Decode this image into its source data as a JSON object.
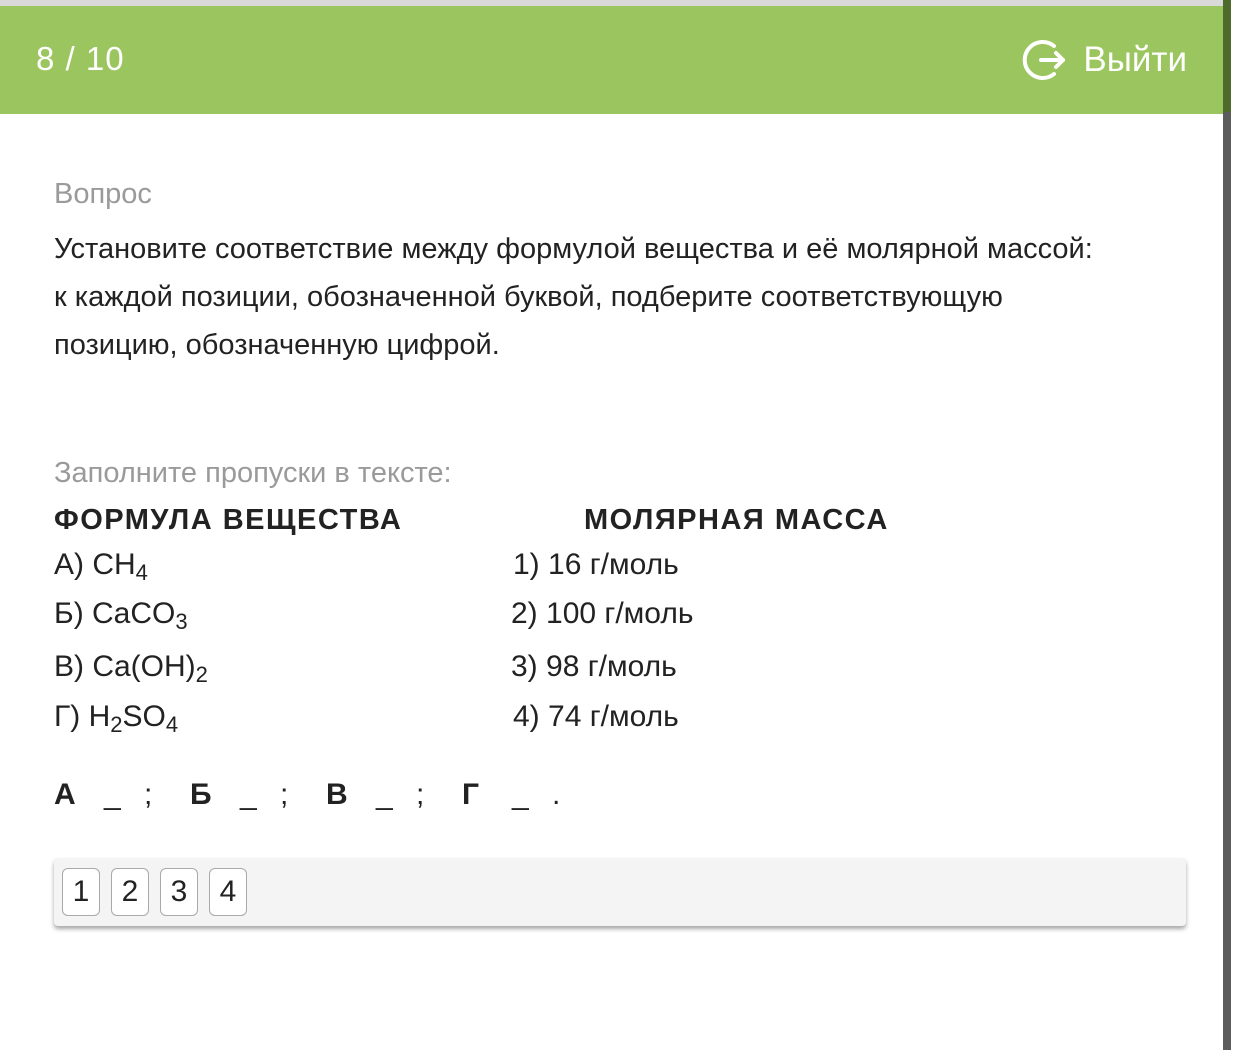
{
  "header": {
    "progress": "8 / 10",
    "exit_label": "Выйти",
    "exit_icon": "logout-icon",
    "background": "#9bc55e"
  },
  "question": {
    "section_label": "Вопрос",
    "text": "Установите соответствие между формулой вещества и её молярной массой: к каждой позиции, обозначенной буквой, подберите соответствующую позицию, обозначенную цифрой."
  },
  "task": {
    "hint": "Заполните пропуски в тексте:",
    "left_header": "ФОРМУЛА ВЕЩЕСТВА",
    "right_header": "МОЛЯРНАЯ МАССА",
    "formulas": [
      {
        "prefix": "А) CH",
        "sub1": "4",
        "mid": "",
        "sub2": ""
      },
      {
        "prefix": "Б) CaCO",
        "sub1": "3",
        "mid": "",
        "sub2": ""
      },
      {
        "prefix": "В) Ca(OH)",
        "sub1": "2",
        "mid": "",
        "sub2": ""
      },
      {
        "prefix": "Г) H",
        "sub1": "2",
        "mid": "SO",
        "sub2": "4"
      }
    ],
    "masses": [
      "1) 16 г/моль",
      "2) 100 г/моль",
      "3) 98 г/моль",
      "4) 74 г/моль"
    ]
  },
  "answer": {
    "slots": [
      {
        "letter": "А",
        "blank": "_",
        "sep": ";"
      },
      {
        "letter": "Б",
        "blank": "_",
        "sep": ";"
      },
      {
        "letter": "В",
        "blank": "_",
        "sep": ";"
      },
      {
        "letter": "Г",
        "blank": "_",
        "sep": "."
      }
    ]
  },
  "options": [
    "1",
    "2",
    "3",
    "4"
  ]
}
